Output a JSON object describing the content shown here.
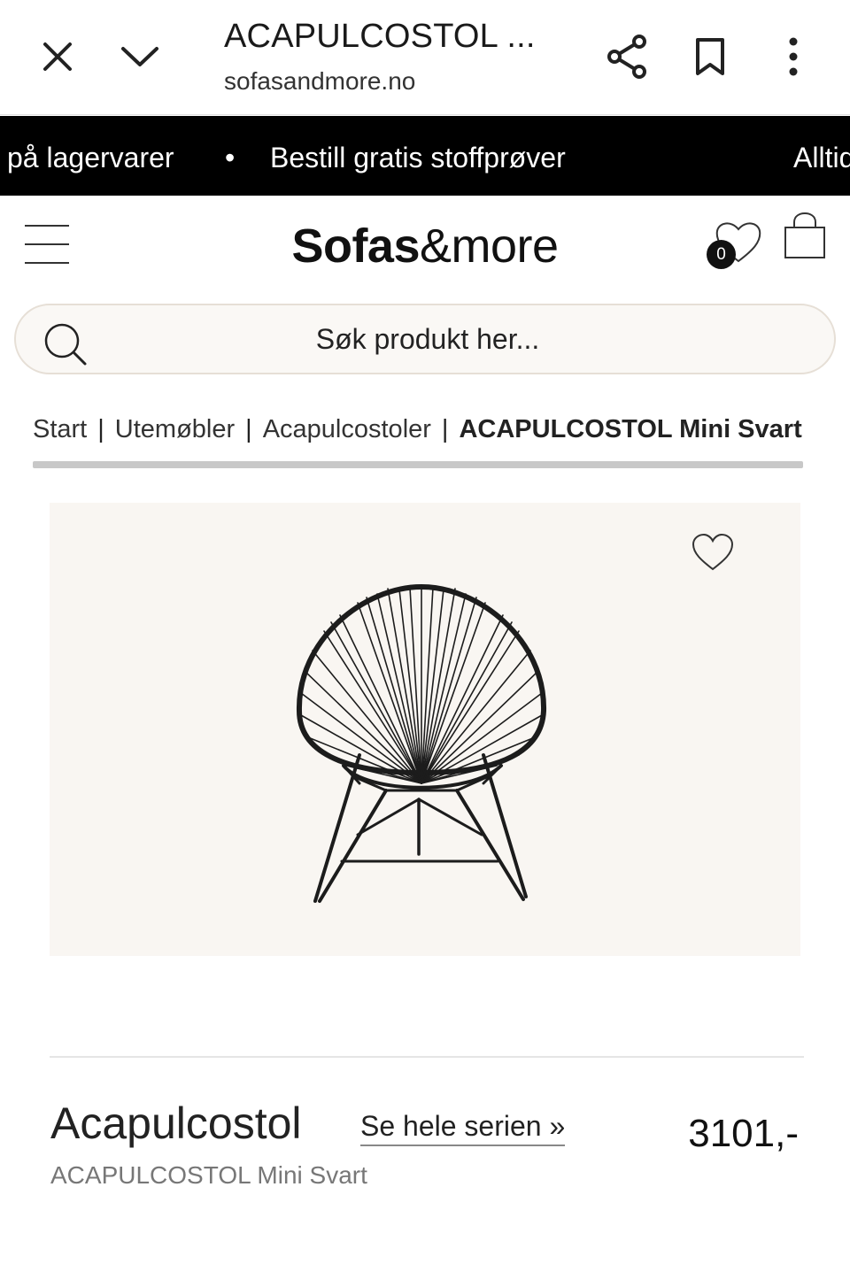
{
  "browser": {
    "title": "ACAPULCOSTOL ...",
    "url": "sofasandmore.no"
  },
  "announcement": {
    "items": [
      "på lagervarer",
      "•",
      "Bestill gratis stoffprøver",
      "Alltid"
    ]
  },
  "header": {
    "logo_bold": "Sofas",
    "logo_rest": "&more",
    "wishlist_count": "0"
  },
  "search": {
    "placeholder": "Søk produkt her..."
  },
  "breadcrumb": {
    "items": [
      "Start",
      "Utemøbler",
      "Acapulcostoler"
    ],
    "current": "ACAPULCOSTOL Mini Svart",
    "separator": "|"
  },
  "product": {
    "name": "Acapulcostol",
    "series_link": "Se hele serien »",
    "price": "3101,-",
    "variant": "ACAPULCOSTOL Mini Svart"
  },
  "colors": {
    "announcement_bg": "#000000",
    "gallery_bg": "#f9f6f2",
    "search_bg": "#faf8f5"
  }
}
